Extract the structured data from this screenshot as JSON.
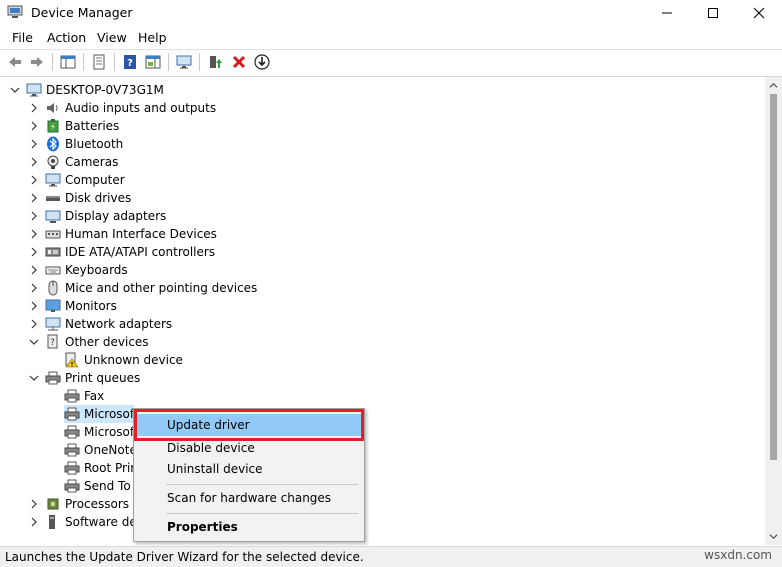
{
  "window": {
    "title": "Device Manager"
  },
  "menu": [
    "File",
    "Action",
    "View",
    "Help"
  ],
  "tree": {
    "root": "DESKTOP-0V73G1M",
    "categories": [
      {
        "label": "Audio inputs and outputs",
        "icon": "speaker-icon"
      },
      {
        "label": "Batteries",
        "icon": "battery-icon"
      },
      {
        "label": "Bluetooth",
        "icon": "bluetooth-icon"
      },
      {
        "label": "Cameras",
        "icon": "camera-icon"
      },
      {
        "label": "Computer",
        "icon": "computer-icon"
      },
      {
        "label": "Disk drives",
        "icon": "disk-drive-icon"
      },
      {
        "label": "Display adapters",
        "icon": "display-adapter-icon"
      },
      {
        "label": "Human Interface Devices",
        "icon": "hid-icon"
      },
      {
        "label": "IDE ATA/ATAPI controllers",
        "icon": "ide-controller-icon"
      },
      {
        "label": "Keyboards",
        "icon": "keyboard-icon"
      },
      {
        "label": "Mice and other pointing devices",
        "icon": "mouse-icon"
      },
      {
        "label": "Monitors",
        "icon": "monitor-icon"
      },
      {
        "label": "Network adapters",
        "icon": "network-adapter-icon"
      },
      {
        "label": "Other devices",
        "icon": "other-devices-icon"
      },
      {
        "label": "Unknown device",
        "icon": "unknown-device-warning-icon"
      },
      {
        "label": "Print queues",
        "icon": "printer-icon"
      },
      {
        "label": "Fax",
        "icon": "printer-icon"
      },
      {
        "label": "Microsof",
        "icon": "printer-icon"
      },
      {
        "label": "Microsof",
        "icon": "printer-icon"
      },
      {
        "label": "OneNote",
        "icon": "printer-icon"
      },
      {
        "label": "Root Prin",
        "icon": "printer-icon"
      },
      {
        "label": "Send To C",
        "icon": "printer-icon"
      },
      {
        "label": "Processors",
        "icon": "processor-icon"
      },
      {
        "label": "Software dev",
        "icon": "software-device-icon"
      }
    ]
  },
  "context_menu": {
    "items": [
      "Update driver",
      "Disable device",
      "Uninstall device",
      "Scan for hardware changes",
      "Properties"
    ]
  },
  "status": {
    "text": "Launches the Update Driver Wizard for the selected device."
  },
  "watermark": "wsxdn.com",
  "colors": {
    "highlight": "#91c9f7",
    "callout_border": "#e0202a"
  }
}
